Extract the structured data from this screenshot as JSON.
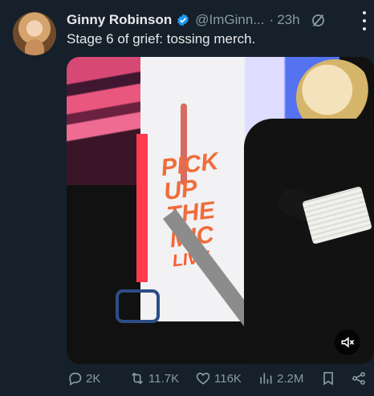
{
  "account": {
    "name": "Ginny Robinson",
    "handle": "@ImGinn...",
    "separator": "·",
    "time": "23h"
  },
  "tweet": {
    "text": "Stage 6 of grief: tossing merch."
  },
  "video": {
    "poster_text_line1": "PICK UP",
    "poster_text_line2": "THE MIC",
    "poster_text_line3": "LIVE"
  },
  "actions": {
    "replies": "2K",
    "reposts": "11.7K",
    "likes": "116K",
    "views": "2.2M"
  },
  "icons": {
    "verified": "verified-badge-icon",
    "grok": "grok-icon",
    "more": "more-options-icon",
    "mute": "mute-icon",
    "reply": "reply-icon",
    "repost": "repost-icon",
    "like": "like-icon",
    "views": "views-icon",
    "bookmark": "bookmark-icon",
    "share": "share-icon"
  },
  "colors": {
    "background": "#15202b",
    "text": "#e7e9ea",
    "secondary": "#8b98a5",
    "verified": "#1d9bf0"
  }
}
